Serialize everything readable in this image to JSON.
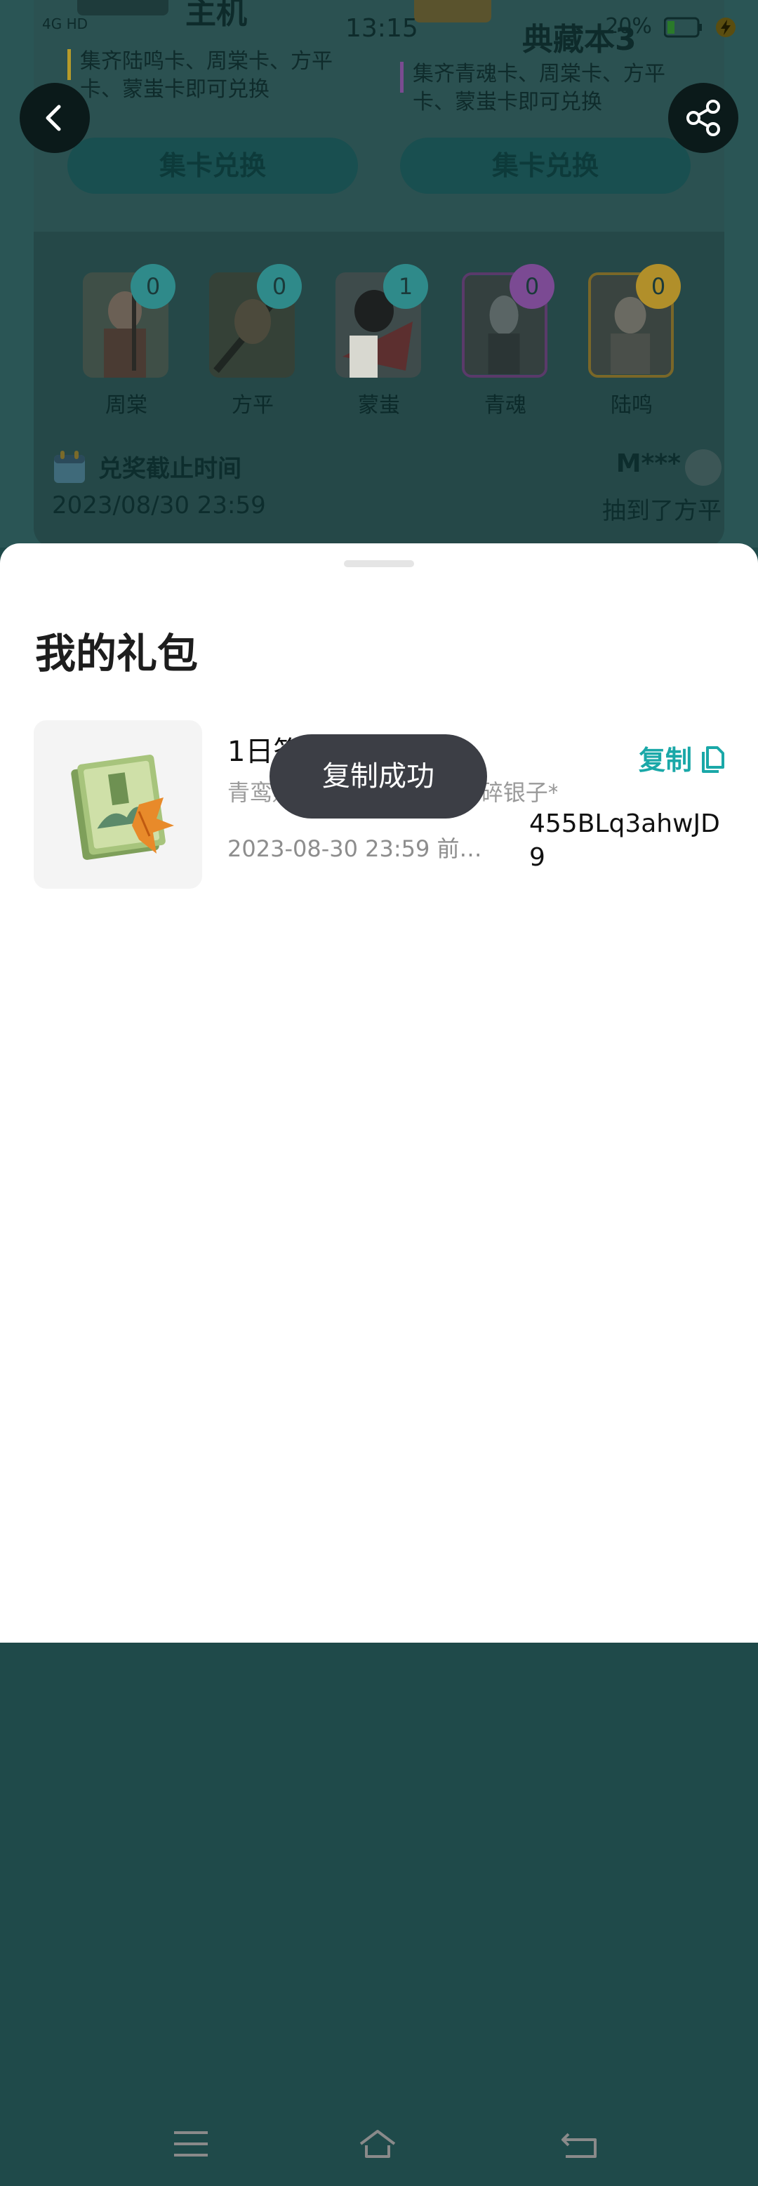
{
  "status_bar": {
    "time": "13:15",
    "battery": "20%",
    "network": "4G HD"
  },
  "prizes": [
    {
      "title": "主机",
      "desc": "集齐陆鸣卡、周棠卡、方平卡、蒙蚩卡即可兑换",
      "button": "集卡兑换"
    },
    {
      "title": "典藏本3",
      "desc": "集齐青魂卡、周棠卡、方平卡、蒙蚩卡即可兑换",
      "button": "集卡兑换"
    }
  ],
  "cards": [
    {
      "name": "周棠",
      "count": "0",
      "badge_color": "#2f8a8a"
    },
    {
      "name": "方平",
      "count": "0",
      "badge_color": "#2f8a8a"
    },
    {
      "name": "蒙蚩",
      "count": "1",
      "badge_color": "#2f8a8a"
    },
    {
      "name": "青魂",
      "count": "0",
      "badge_color": "#7b4a93"
    },
    {
      "name": "陆鸣",
      "count": "0",
      "badge_color": "#b18f2a"
    }
  ],
  "deadline": {
    "label": "兑奖截止时间",
    "value": "2023/08/30 23:59"
  },
  "winner": {
    "name": "M***",
    "text": "抽到了方平"
  },
  "sheet": {
    "title": "我的礼包",
    "gift": {
      "name": "1日签到礼包",
      "desc": "青鸾赐福*1、白纸扇*1、碎银子*…",
      "expiry": "2023-08-30 23:59 前…",
      "copy_label": "复制",
      "code": "455BLq3ahwJD9"
    }
  },
  "toast": "复制成功",
  "colors": {
    "accent": "#1aa8a8",
    "toast_bg": "#3c3e45"
  }
}
